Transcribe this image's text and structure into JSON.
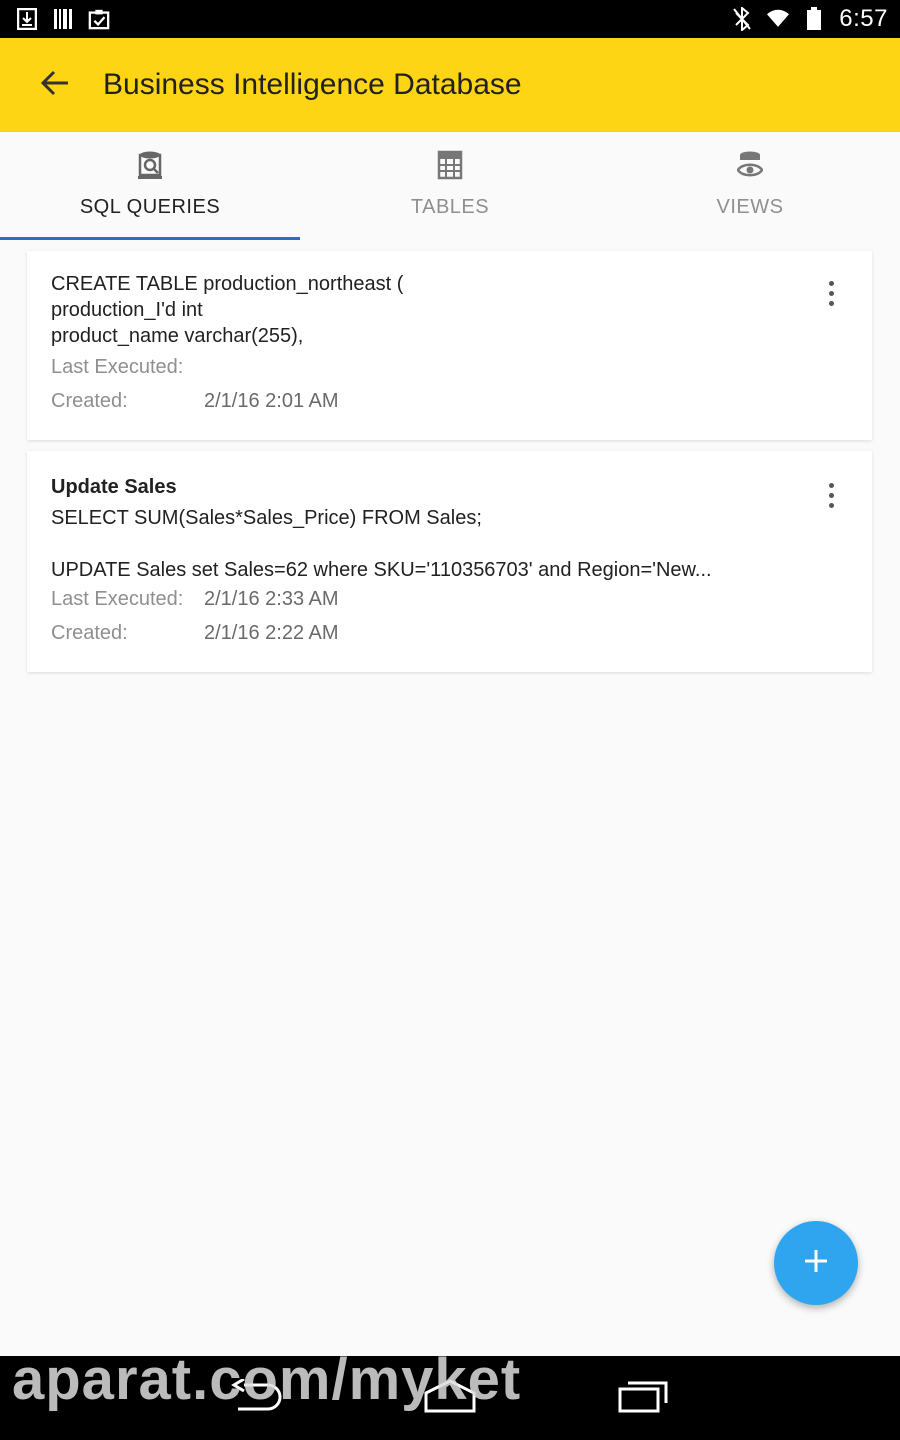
{
  "status_bar": {
    "time": "6:57",
    "left_icons": [
      "download-notification-icon",
      "barcode-icon",
      "clipboard-check-icon"
    ],
    "right_icons": [
      "bluetooth-off-icon",
      "wifi-icon",
      "battery-icon"
    ]
  },
  "toolbar": {
    "title": "Business Intelligence Database",
    "background": "#fdd514"
  },
  "tabs": [
    {
      "label": "SQL QUERIES",
      "icon": "sql-query-icon",
      "active": true
    },
    {
      "label": "TABLES",
      "icon": "table-icon",
      "active": false
    },
    {
      "label": "VIEWS",
      "icon": "view-icon",
      "active": false
    }
  ],
  "queries": [
    {
      "lines": [
        "CREATE TABLE production_northeast (",
        "production_I'd int",
        "product_name varchar(255),"
      ],
      "last_executed_label": "Last Executed:",
      "last_executed": "",
      "created_label": "Created:",
      "created": "2/1/16 2:01 AM"
    },
    {
      "title": "Update Sales",
      "lines": [
        "SELECT SUM(Sales*Sales_Price) FROM Sales;",
        "UPDATE Sales set Sales=62 where SKU='110356703' and Region='New..."
      ],
      "last_executed_label": "Last Executed:",
      "last_executed": "2/1/16 2:33 AM",
      "created_label": "Created:",
      "created": "2/1/16 2:22 AM"
    }
  ],
  "fab": {
    "icon": "plus-icon",
    "color": "#2ea5ee"
  },
  "nav_bar": {
    "buttons": [
      "back-nav-icon",
      "home-nav-icon",
      "recents-nav-icon"
    ]
  },
  "watermark": "aparat.com/myket"
}
